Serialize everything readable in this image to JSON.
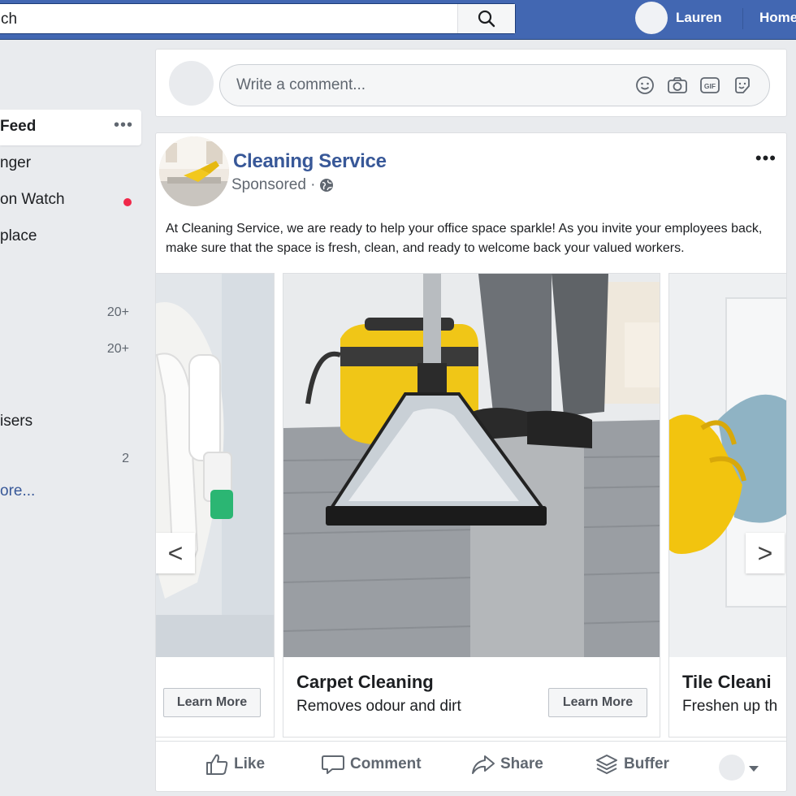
{
  "topbar": {
    "search_text": "ch",
    "profile_name": "Lauren",
    "home_label": "Home"
  },
  "sidebar": {
    "items": [
      {
        "label": "Feed",
        "active": true
      },
      {
        "label": "nger"
      },
      {
        "label": "on Watch",
        "notification_dot": true
      },
      {
        "label": "place"
      },
      {
        "label": "",
        "count": "20+"
      },
      {
        "label": "",
        "count": "20+"
      },
      {
        "label": "isers"
      },
      {
        "label": "",
        "count": "2"
      },
      {
        "label": "ore..."
      }
    ]
  },
  "comment_box": {
    "placeholder": "Write a comment...",
    "icons": [
      "emoji-icon",
      "camera-icon",
      "gif-icon",
      "sticker-icon"
    ]
  },
  "post": {
    "page_name": "Cleaning Service",
    "sponsored_label": "Sponsored ·",
    "body": "At Cleaning Service, we are ready to help your office space sparkle! As you invite your employees back, make sure that the space is fresh, clean, and ready to welcome back your valued workers.",
    "carousel": [
      {
        "title": "",
        "subtitle": "",
        "button": "Learn More"
      },
      {
        "title": "Carpet Cleaning",
        "subtitle": "Removes odour and dirt",
        "button": "Learn More"
      },
      {
        "title": "Tile Cleani",
        "subtitle": "Freshen up th",
        "button": ""
      }
    ],
    "prev_arrow": "<",
    "next_arrow": ">",
    "actions": {
      "like": "Like",
      "comment": "Comment",
      "share": "Share",
      "buffer": "Buffer"
    }
  },
  "colors": {
    "topbar": "#4267b2",
    "link": "#385898",
    "background": "#e9ebee",
    "notification": "#f02849"
  }
}
